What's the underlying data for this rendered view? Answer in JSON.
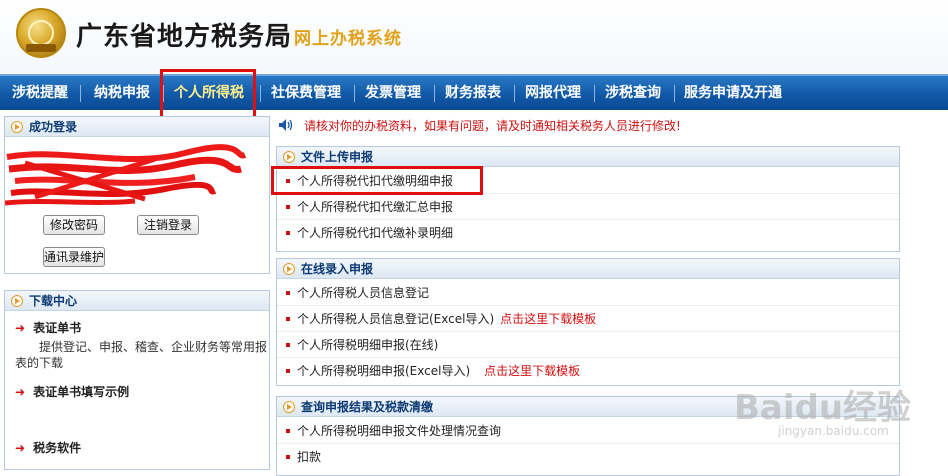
{
  "header": {
    "title": "广东省地方税务局",
    "subtitle": "网上办税系统"
  },
  "nav": {
    "items": [
      {
        "label": "涉税提醒"
      },
      {
        "label": "纳税申报"
      },
      {
        "label": "个人所得税"
      },
      {
        "label": "社保费管理"
      },
      {
        "label": "发票管理"
      },
      {
        "label": "财务报表"
      },
      {
        "label": "网报代理"
      },
      {
        "label": "涉税查询"
      },
      {
        "label": "服务申请及开通"
      }
    ],
    "active_index": 2
  },
  "login_panel": {
    "title": "成功登录",
    "buttons": {
      "change_password": "修改密码",
      "logout": "注销登录",
      "contacts": "通讯录维护"
    }
  },
  "download_panel": {
    "title": "下载中心",
    "items": [
      {
        "label": "表证单书",
        "desc": "提供登记、申报、稽查、企业财务等常用报表的下载"
      },
      {
        "label": "表证单书填写示例"
      },
      {
        "label": "税务软件"
      }
    ]
  },
  "notice": {
    "text": "请核对你的办税资料，如果有问题，请及时通知相关税务人员进行修改!"
  },
  "upload_section": {
    "title": "文件上传申报",
    "rows": [
      {
        "label": "个人所得税代扣代缴明细申报"
      },
      {
        "label": "个人所得税代扣代缴汇总申报"
      },
      {
        "label": "个人所得税代扣代缴补录明细"
      }
    ]
  },
  "online_section": {
    "title": "在线录入申报",
    "rows": [
      {
        "label": "个人所得税人员信息登记",
        "link": ""
      },
      {
        "label": "个人所得税人员信息登记(Excel导入)",
        "link": "点击这里下载模板"
      },
      {
        "label": "个人所得税明细申报(在线)",
        "link": ""
      },
      {
        "label": "个人所得税明细申报(Excel导入)",
        "link": "点击这里下载模板"
      }
    ]
  },
  "query_section": {
    "title": "查询申报结果及税款清缴",
    "rows": [
      {
        "label": "个人所得税明细申报文件处理情况查询"
      },
      {
        "label": "扣款"
      }
    ]
  },
  "watermark": {
    "brand": "Baidu经验",
    "url": "jingyan.baidu.com"
  },
  "colors": {
    "nav_bg": "#1159a8",
    "accent_red": "#d01010",
    "subtitle_gold": "#e0a21a",
    "annotation_box": "#e01010"
  }
}
